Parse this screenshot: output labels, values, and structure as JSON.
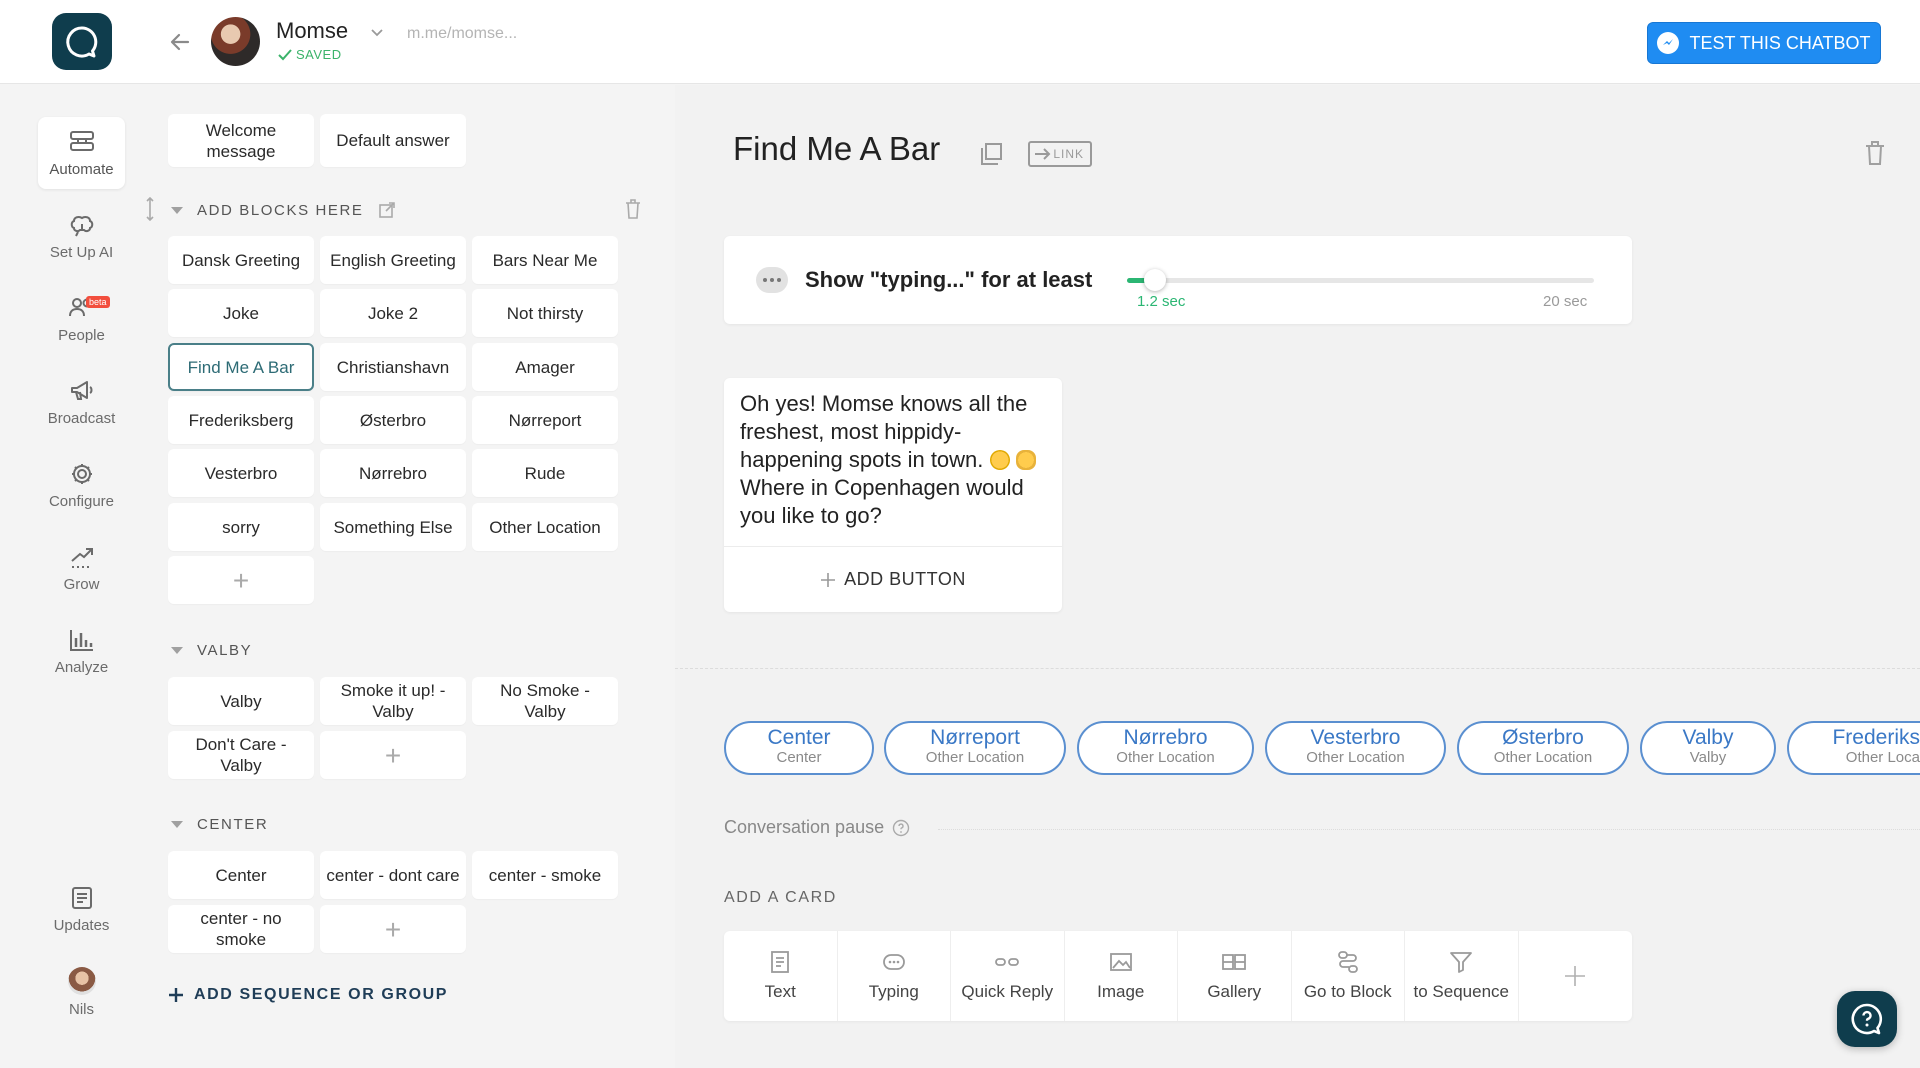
{
  "header": {
    "bot_name": "Momse",
    "saved_label": "SAVED",
    "bot_link": "m.me/momse...",
    "test_button": "TEST THIS CHATBOT"
  },
  "nav": {
    "items": [
      {
        "label": "Automate",
        "icon": "automate-icon",
        "active": true
      },
      {
        "label": "Set Up AI",
        "icon": "brain-icon"
      },
      {
        "label": "People",
        "icon": "people-icon",
        "badge": "beta"
      },
      {
        "label": "Broadcast",
        "icon": "megaphone-icon"
      },
      {
        "label": "Configure",
        "icon": "gear-icon"
      },
      {
        "label": "Grow",
        "icon": "grow-icon"
      },
      {
        "label": "Analyze",
        "icon": "bar-chart-icon"
      }
    ],
    "updates": "Updates",
    "user": "Nils"
  },
  "blocks": {
    "fixed": [
      "Welcome message",
      "Default answer"
    ],
    "group_main": {
      "title": "ADD BLOCKS HERE",
      "items": [
        "Dansk Greeting",
        "English Greeting",
        "Bars Near Me",
        "Joke",
        "Joke 2",
        "Not thirsty",
        "Find Me A Bar",
        "Christianshavn",
        "Amager",
        "Frederiksberg",
        "Østerbro",
        "Nørreport",
        "Vesterbro",
        "Nørrebro",
        "Rude",
        "sorry",
        "Something Else",
        "Other Location"
      ]
    },
    "group_valby": {
      "title": "VALBY",
      "items": [
        "Valby",
        "Smoke it up! - Valby",
        "No Smoke - Valby",
        "Don't Care - Valby"
      ]
    },
    "group_center": {
      "title": "CENTER",
      "items": [
        "Center",
        "center - dont care",
        "center - smoke",
        "center - no smoke"
      ]
    },
    "add_sequence": "ADD SEQUENCE OR GROUP"
  },
  "editor": {
    "title": "Find Me A Bar",
    "link_label": "LINK",
    "typing": {
      "label": "Show \"typing...\" for at least",
      "value": "1.2 sec",
      "max": "20 sec",
      "fraction": 0.06
    },
    "message": {
      "line1": "Oh yes! Momse knows all the freshest, most hippidy-happening spots in town.",
      "line2": "Where in Copenhagen would you like to go?",
      "add_button": "ADD BUTTON"
    },
    "quick_replies": [
      {
        "title": "Center",
        "sub": "Center"
      },
      {
        "title": "Nørreport",
        "sub": "Other Location"
      },
      {
        "title": "Nørrebro",
        "sub": "Other Location"
      },
      {
        "title": "Vesterbro",
        "sub": "Other Location"
      },
      {
        "title": "Østerbro",
        "sub": "Other Location"
      },
      {
        "title": "Valby",
        "sub": "Valby"
      },
      {
        "title": "Frederiks",
        "sub": "Other Loca"
      }
    ],
    "pause_label": "Conversation pause",
    "add_card_label": "ADD A CARD",
    "card_types": [
      "Text",
      "Typing",
      "Quick Reply",
      "Image",
      "Gallery",
      "Go to Block",
      "to Sequence"
    ]
  },
  "colors": {
    "brand": "#0f3d4d",
    "accent_blue": "#1f8cf2",
    "saved_green": "#3bb36a",
    "quick_reply_border": "#5a8fd0"
  }
}
